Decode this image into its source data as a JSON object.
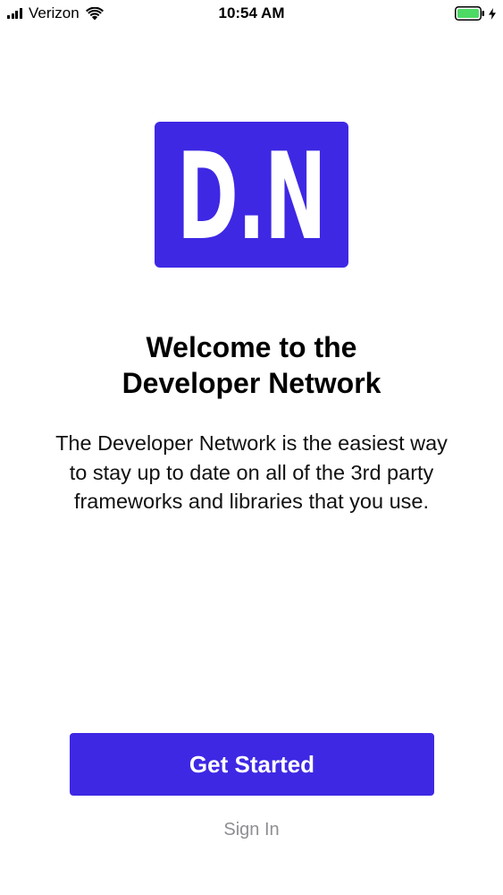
{
  "status_bar": {
    "carrier": "Verizon",
    "time": "10:54 AM",
    "signal_icon": "cellular-signal-icon",
    "wifi_icon": "wifi-icon",
    "battery_icon": "battery-icon",
    "charging_icon": "charging-bolt-icon",
    "battery_color": "#4cd964"
  },
  "logo": {
    "text": "D.N",
    "background_color": "#3e28e4"
  },
  "welcome": {
    "title_line1": "Welcome to the",
    "title_line2": "Developer Network",
    "description": "The Developer Network is the easiest way to stay up to date on all of the 3rd party frameworks and libraries that you use."
  },
  "actions": {
    "get_started_label": "Get Started",
    "sign_in_label": "Sign In",
    "accent_color": "#3e28e4"
  }
}
